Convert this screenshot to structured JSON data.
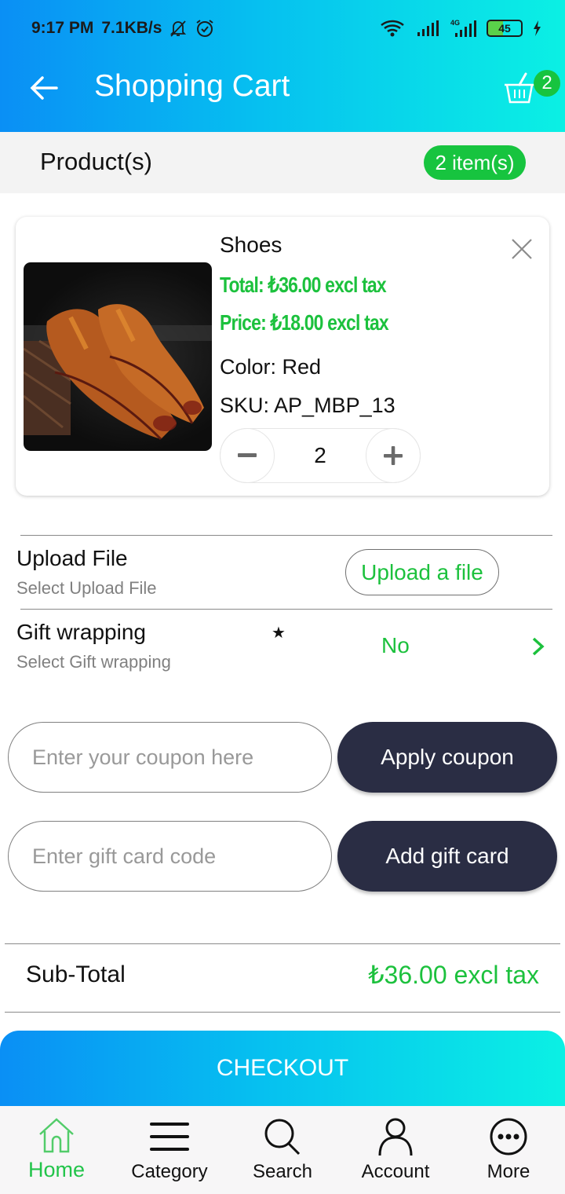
{
  "status_bar": {
    "time": "9:17 PM",
    "net_speed": "7.1KB/s",
    "network_type": "4G",
    "battery_level": "45"
  },
  "app_bar": {
    "title": "Shopping Cart",
    "cart_count": "2",
    "back_icon": "arrow-left-icon",
    "cart_icon": "basket-icon"
  },
  "products_header": {
    "label": "Product(s)",
    "items_badge": "2 item(s)"
  },
  "cart_items": [
    {
      "name": "Shoes",
      "total": "Total: ₺36.00 excl tax",
      "price": "Price: ₺18.00 excl tax",
      "color": "Color: Red",
      "sku": "SKU: AP_MBP_13",
      "quantity": "2",
      "image_alt": "brown leather shoes"
    }
  ],
  "upload_file": {
    "title": "Upload File",
    "subtitle": "Select Upload File",
    "button": "Upload a file"
  },
  "gift_wrapping": {
    "title": "Gift wrapping",
    "subtitle": "Select Gift wrapping",
    "required_mark": "★",
    "value": "No"
  },
  "coupon": {
    "placeholder": "Enter your coupon here",
    "button": "Apply coupon"
  },
  "gift_card": {
    "placeholder": "Enter gift card code",
    "button": "Add gift card"
  },
  "subtotal": {
    "label": "Sub-Total",
    "value": "₺36.00 excl tax"
  },
  "checkout": {
    "label": "CHECKOUT"
  },
  "bottom_nav": {
    "items": [
      {
        "label": "Home",
        "icon": "home-icon",
        "active": true
      },
      {
        "label": "Category",
        "icon": "menu-icon",
        "active": false
      },
      {
        "label": "Search",
        "icon": "search-icon",
        "active": false
      },
      {
        "label": "Account",
        "icon": "user-icon",
        "active": false
      },
      {
        "label": "More",
        "icon": "more-icon",
        "active": false
      }
    ]
  },
  "colors": {
    "accent_green": "#1cc13d",
    "dark_button": "#2a2d44",
    "gradient_start": "#0a8ff5",
    "gradient_end": "#0bf0e4"
  }
}
